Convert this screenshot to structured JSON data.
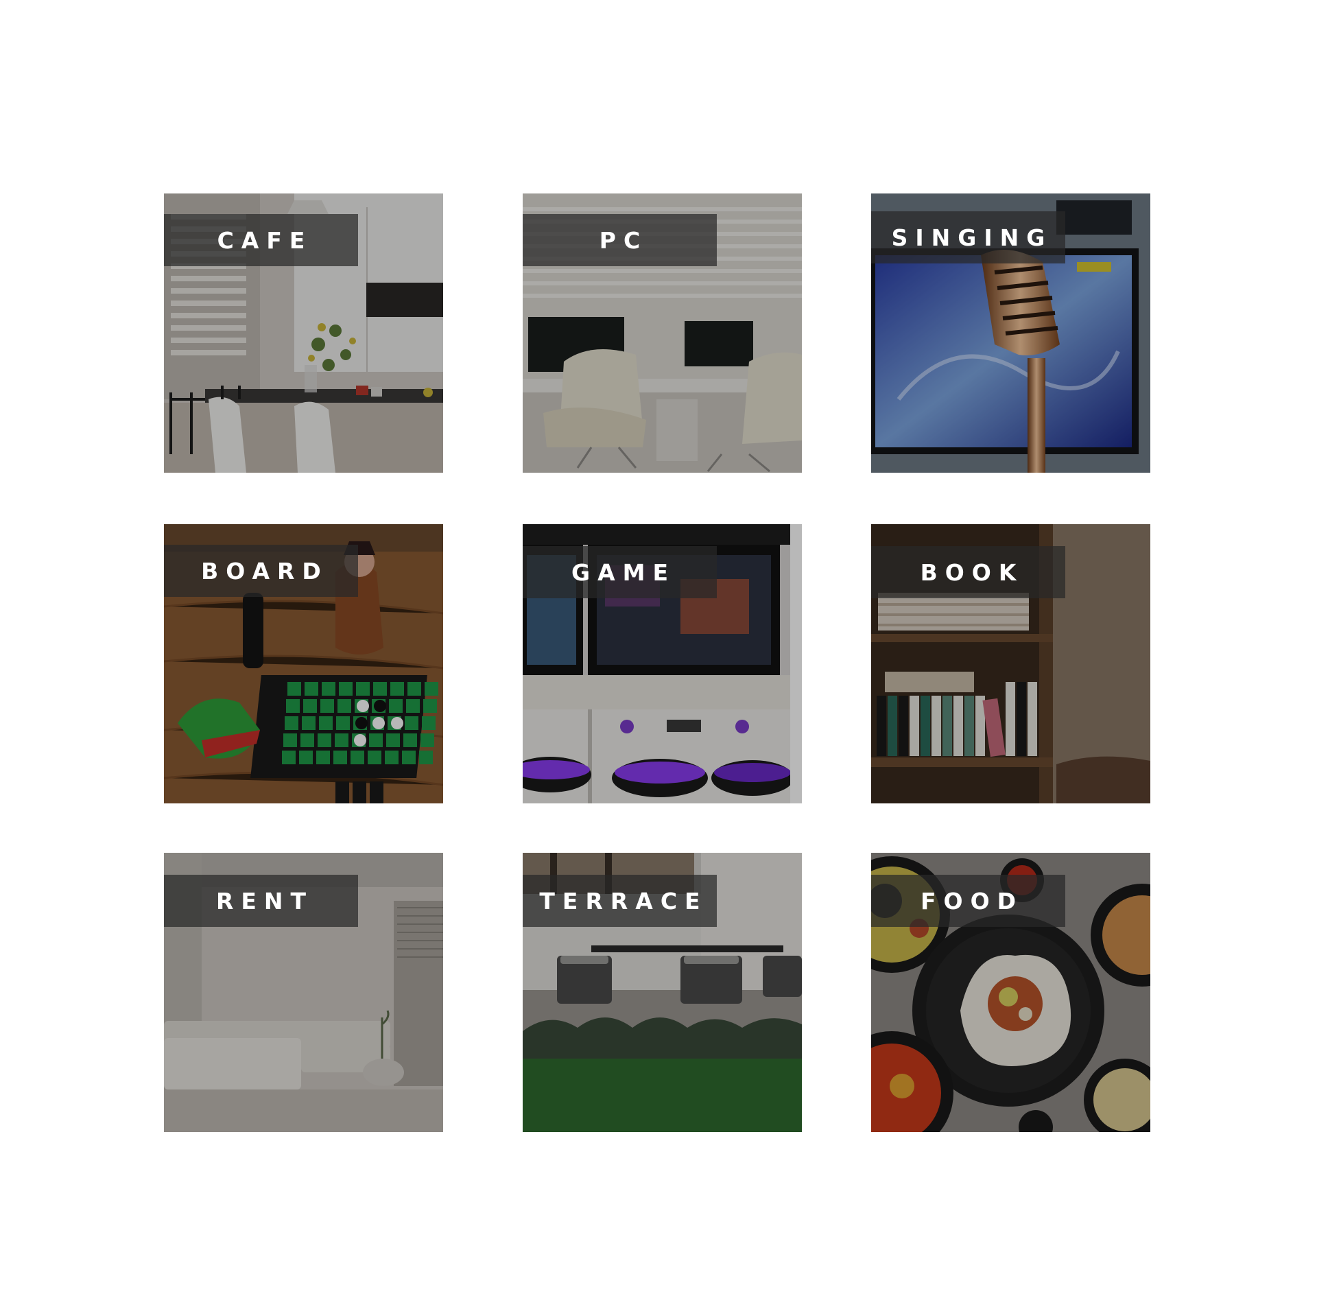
{
  "tiles": [
    {
      "id": "cafe",
      "label": "CAFE",
      "scene": "cafe-interior-image"
    },
    {
      "id": "pc",
      "label": "PC",
      "scene": "pc-room-image"
    },
    {
      "id": "singing",
      "label": "SINGING",
      "scene": "karaoke-microphone-image"
    },
    {
      "id": "board",
      "label": "BOARD",
      "scene": "board-games-image"
    },
    {
      "id": "game",
      "label": "GAME",
      "scene": "arcade-machines-image"
    },
    {
      "id": "book",
      "label": "BOOK",
      "scene": "bookshelf-image"
    },
    {
      "id": "rent",
      "label": "RENT",
      "scene": "rental-room-image"
    },
    {
      "id": "terrace",
      "label": "TERRACE",
      "scene": "terrace-image"
    },
    {
      "id": "food",
      "label": "FOOD",
      "scene": "food-dishes-image"
    }
  ]
}
